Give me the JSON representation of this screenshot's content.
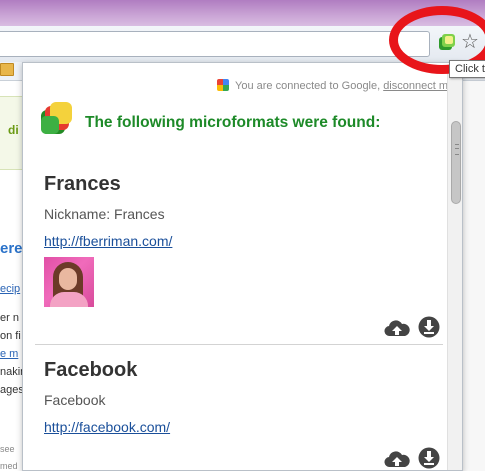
{
  "browser": {
    "extension_icon": "microformats-extension-icon",
    "star_icon": "bookmark-star-icon",
    "tooltip": "Click t"
  },
  "background_page": {
    "fragments": [
      {
        "text": "di",
        "style": "green"
      },
      {
        "text": "ere",
        "style": "blue"
      },
      {
        "text": "ecip",
        "style": "link"
      },
      {
        "text": "er n",
        "style": "plain"
      },
      {
        "text": "on fi",
        "style": "plain"
      },
      {
        "text": "e m",
        "style": "link"
      },
      {
        "text": "nakin",
        "style": "plain"
      },
      {
        "text": "ages",
        "style": "plain"
      },
      {
        "text": "see",
        "style": "small"
      },
      {
        "text": "med",
        "style": "small"
      }
    ]
  },
  "popup": {
    "connected_text": "You are connected to Google,",
    "disconnect_label": "disconnect m",
    "heading": "The following microformats were found:",
    "cards": [
      {
        "title": "Frances",
        "subtitle": "Nickname: Frances",
        "link": "http://fberriman.com/",
        "has_avatar": true
      },
      {
        "title": "Facebook",
        "subtitle": "Facebook",
        "link": "http://facebook.com/",
        "has_avatar": false
      }
    ]
  },
  "colors": {
    "heading_green": "#1d8a28",
    "link_blue": "#1a4f9a",
    "annotation_red": "#e8151a"
  }
}
